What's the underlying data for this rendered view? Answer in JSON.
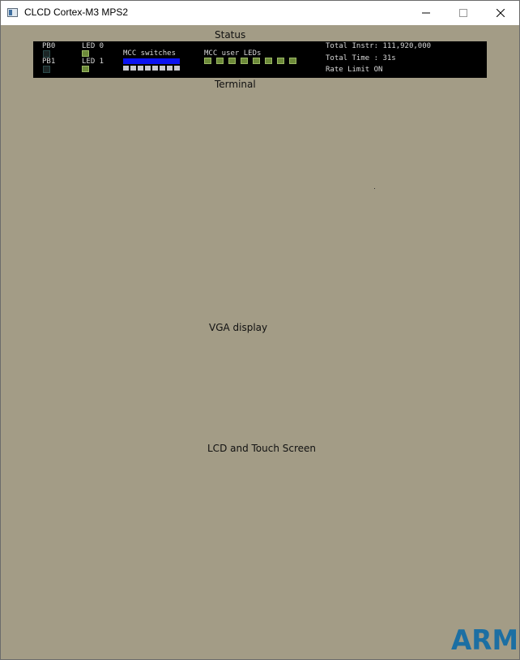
{
  "window": {
    "title": "CLCD Cortex-M3 MPS2",
    "icon": "app-window-icon",
    "controls": [
      "minimize-icon",
      "maximize-icon",
      "close-icon"
    ]
  },
  "sections": {
    "status": "Status",
    "terminal": "Terminal",
    "vga": "VGA display",
    "lcd": "LCD and Touch Screen"
  },
  "status_panel": {
    "pb0": "PB0",
    "pb1": "PB1",
    "led0": "LED 0",
    "led1": "LED 1",
    "mcc_switches": "MCC switches",
    "mcc_switch_count": 8,
    "mcc_user_leds": "MCC user LEDs",
    "mcc_led_count": 8,
    "total_instr": "Total Instr: 111,920,000",
    "total_time": "Total Time : 31s",
    "rate_limit": "Rate Limit ON"
  },
  "logo": {
    "text": "ARM",
    "color": "#1c6fa3"
  },
  "colors": {
    "background": "#a39c86",
    "status_panel": "#000000",
    "switch_bar": "#0b12f0",
    "led_on": "#6d8a3a"
  }
}
